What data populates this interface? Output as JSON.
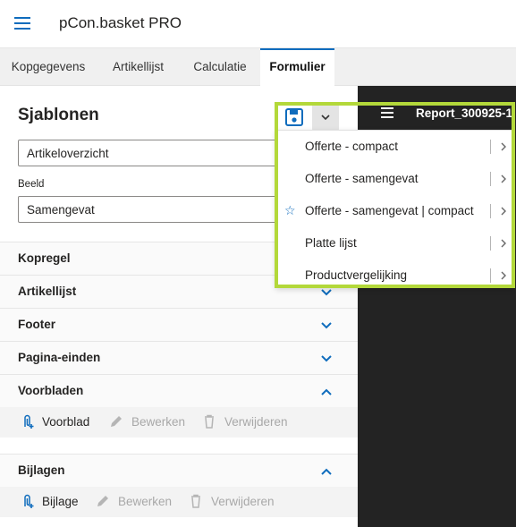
{
  "app": {
    "title": "pCon.basket PRO",
    "menu_icon": "hamburger-icon"
  },
  "tabs": [
    {
      "label": "Kopgegevens",
      "active": false
    },
    {
      "label": "Artikellijst",
      "active": false
    },
    {
      "label": "Calculatie",
      "active": false
    },
    {
      "label": "Formulier",
      "active": true
    }
  ],
  "templates": {
    "heading": "Sjablonen",
    "template_value": "Artikeloverzicht",
    "view_label": "Beeld",
    "view_value": "Samengevat",
    "save_icon": "save-icon",
    "dropdown_icon": "chevron-down-icon"
  },
  "sections": [
    {
      "title": "Kopregel",
      "expanded": false
    },
    {
      "title": "Artikellijst",
      "expanded": false
    },
    {
      "title": "Footer",
      "expanded": false
    },
    {
      "title": "Pagina-einden",
      "expanded": false
    },
    {
      "title": "Voorbladen",
      "expanded": true,
      "actions": {
        "add": "Voorblad",
        "edit": "Bewerken",
        "delete": "Verwijderen"
      }
    },
    {
      "title": "Bijlagen",
      "expanded": true,
      "actions": {
        "add": "Bijlage",
        "edit": "Bewerken",
        "delete": "Verwijderen"
      }
    }
  ],
  "preview": {
    "report_title": "Report_300925-1"
  },
  "template_menu": [
    {
      "label": "Offerte - compact",
      "favorite": false
    },
    {
      "label": "Offerte - samengevat",
      "favorite": false
    },
    {
      "label": "Offerte - samengevat | compact",
      "favorite": true
    },
    {
      "label": "Platte lijst",
      "favorite": false
    },
    {
      "label": "Productvergelijking",
      "favorite": false
    }
  ],
  "colors": {
    "accent": "#0f6cbd",
    "highlight": "#b3d83a",
    "preview_background": "#232323"
  }
}
